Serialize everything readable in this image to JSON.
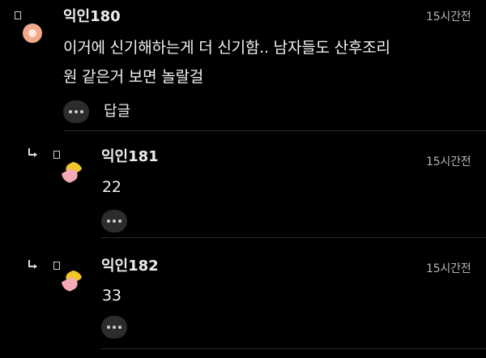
{
  "comments": [
    {
      "author": "익인180",
      "time": "15시간전",
      "text_line1": "이거에 신기해하는게 더 신기함.. 남자들도 산후조리",
      "text_line2": "원 같은거 보면 놀랄걸",
      "reply_label": "답글"
    },
    {
      "author": "익인181",
      "time": "15시간전",
      "text": "22"
    },
    {
      "author": "익인182",
      "time": "15시간전",
      "text": "33"
    }
  ]
}
